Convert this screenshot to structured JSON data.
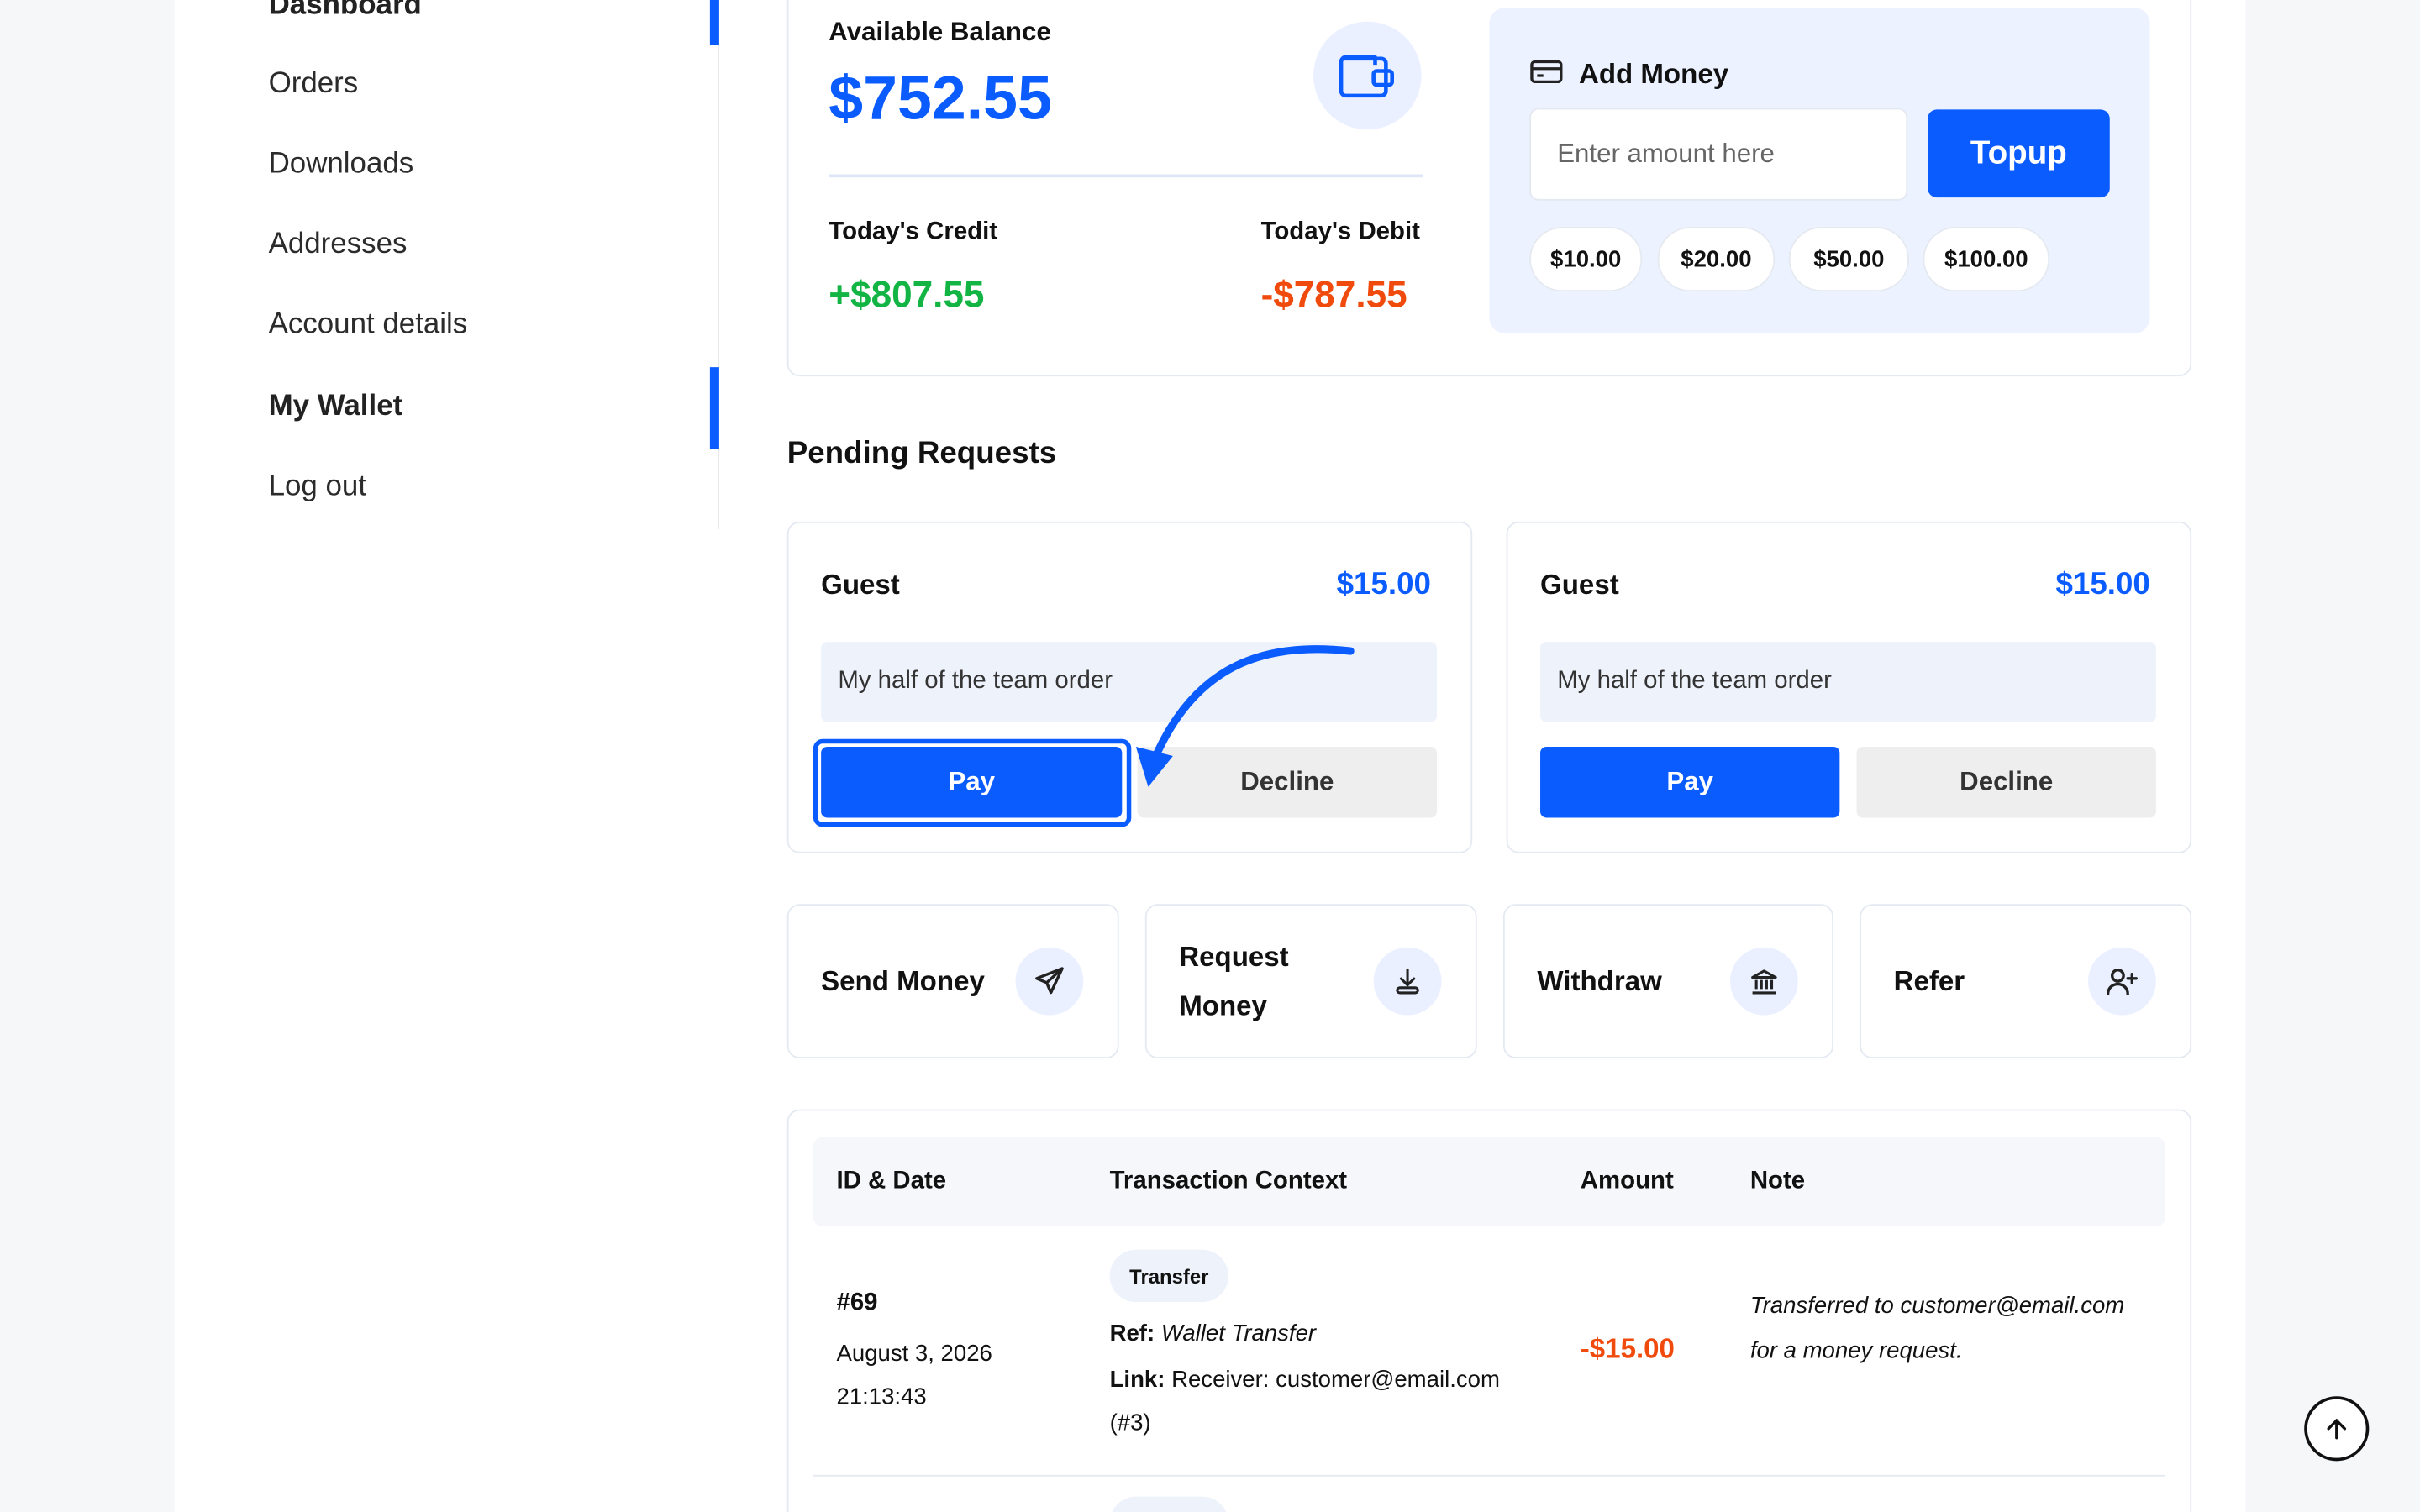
{
  "sidebar": {
    "items": [
      {
        "label": "Dashboard"
      },
      {
        "label": "Orders"
      },
      {
        "label": "Downloads"
      },
      {
        "label": "Addresses"
      },
      {
        "label": "Account details"
      },
      {
        "label": "My Wallet",
        "active": true
      },
      {
        "label": "Log out"
      }
    ]
  },
  "balance": {
    "label": "Available Balance",
    "amount": "$752.55",
    "credit_label": "Today's Credit",
    "credit_value": "+$807.55",
    "debit_label": "Today's Debit",
    "debit_value": "-$787.55",
    "icon": "wallet-icon"
  },
  "add_money": {
    "title": "Add Money",
    "placeholder": "Enter amount here",
    "value": "",
    "topup_label": "Topup",
    "quick_amounts": [
      "$10.00",
      "$20.00",
      "$50.00",
      "$100.00"
    ],
    "icon": "card-icon"
  },
  "pending": {
    "title": "Pending Requests",
    "requests": [
      {
        "name": "Guest",
        "amount": "$15.00",
        "note": "My half of the team order",
        "pay_label": "Pay",
        "decline_label": "Decline"
      },
      {
        "name": "Guest",
        "amount": "$15.00",
        "note": "My half of the team order",
        "pay_label": "Pay",
        "decline_label": "Decline"
      }
    ]
  },
  "actions": [
    {
      "label_line1": "Send Money",
      "label_line2": "",
      "icon": "send-icon"
    },
    {
      "label_line1": "Request",
      "label_line2": "Money",
      "icon": "download-icon"
    },
    {
      "label_line1": "Withdraw",
      "label_line2": "",
      "icon": "bank-icon"
    },
    {
      "label_line1": "Refer",
      "label_line2": "",
      "icon": "user-plus-icon"
    }
  ],
  "table": {
    "headers": [
      "ID & Date",
      "Transaction Context",
      "Amount",
      "Note"
    ],
    "rows": [
      {
        "id": "#69",
        "date": "August 3, 2026",
        "time": "21:13:43",
        "badge": "Transfer",
        "ref_label": "Ref:",
        "ref_value": "Wallet Transfer",
        "link_label": "Link:",
        "link_value": "Receiver: customer@email.com",
        "link_value2": "(#3)",
        "amount": "-$15.00",
        "note": "Transferred to customer@email.com for a money request."
      }
    ]
  },
  "colors": {
    "accent": "#0a5cff",
    "credit": "#12b544",
    "debit": "#f04b0c",
    "background": "#f6f7f9"
  }
}
